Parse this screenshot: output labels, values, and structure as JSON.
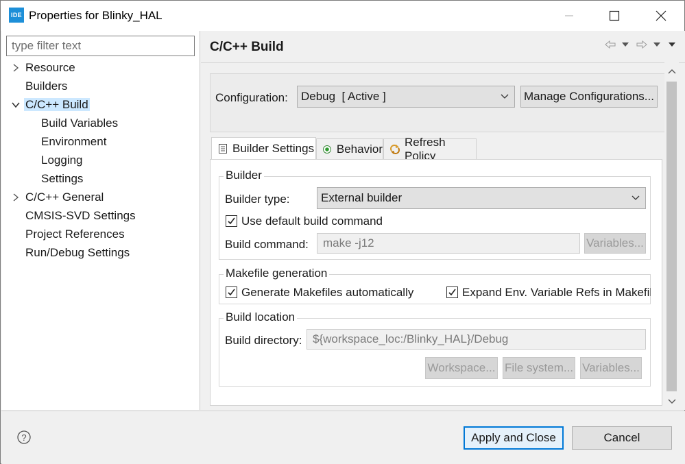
{
  "window": {
    "title": "Properties for Blinky_HAL",
    "app_icon_text": "IDE"
  },
  "sidebar": {
    "filter_placeholder": "type filter text",
    "items": [
      {
        "label": "Resource",
        "expandable": true,
        "expanded": false
      },
      {
        "label": "Builders"
      },
      {
        "label": "C/C++ Build",
        "expandable": true,
        "expanded": true,
        "selected": true
      },
      {
        "label": "Build Variables"
      },
      {
        "label": "Environment"
      },
      {
        "label": "Logging"
      },
      {
        "label": "Settings"
      },
      {
        "label": "C/C++ General",
        "expandable": true,
        "expanded": false
      },
      {
        "label": "CMSIS-SVD Settings"
      },
      {
        "label": "Project References"
      },
      {
        "label": "Run/Debug Settings"
      }
    ]
  },
  "page": {
    "title": "C/C++ Build",
    "configuration": {
      "label": "Configuration:",
      "value": "Debug  [ Active ]",
      "manage_button": "Manage Configurations..."
    },
    "tabs": [
      {
        "label": "Builder Settings",
        "icon": "list-icon",
        "active": true
      },
      {
        "label": "Behavior",
        "icon": "radio-icon"
      },
      {
        "label": "Refresh Policy",
        "icon": "refresh-icon"
      }
    ],
    "builder": {
      "group_title": "Builder",
      "type_label": "Builder type:",
      "type_value": "External builder",
      "use_default_label": "Use default build command",
      "use_default_checked": true,
      "command_label": "Build command:",
      "command_value": "make -j12",
      "variables_button": "Variables..."
    },
    "makefile": {
      "group_title": "Makefile generation",
      "generate_label": "Generate Makefiles automatically",
      "generate_checked": true,
      "expand_label": "Expand Env. Variable Refs in Makefiles",
      "expand_checked": true
    },
    "location": {
      "group_title": "Build location",
      "directory_label": "Build directory:",
      "directory_value": "${workspace_loc:/Blinky_HAL}/Debug",
      "workspace_button": "Workspace...",
      "filesystem_button": "File system...",
      "variables_button": "Variables..."
    }
  },
  "footer": {
    "apply_close": "Apply and Close",
    "cancel": "Cancel"
  },
  "colors": {
    "accent": "#0078d7",
    "selection": "#cce8ff",
    "icon_blue": "#1d8fd8"
  }
}
